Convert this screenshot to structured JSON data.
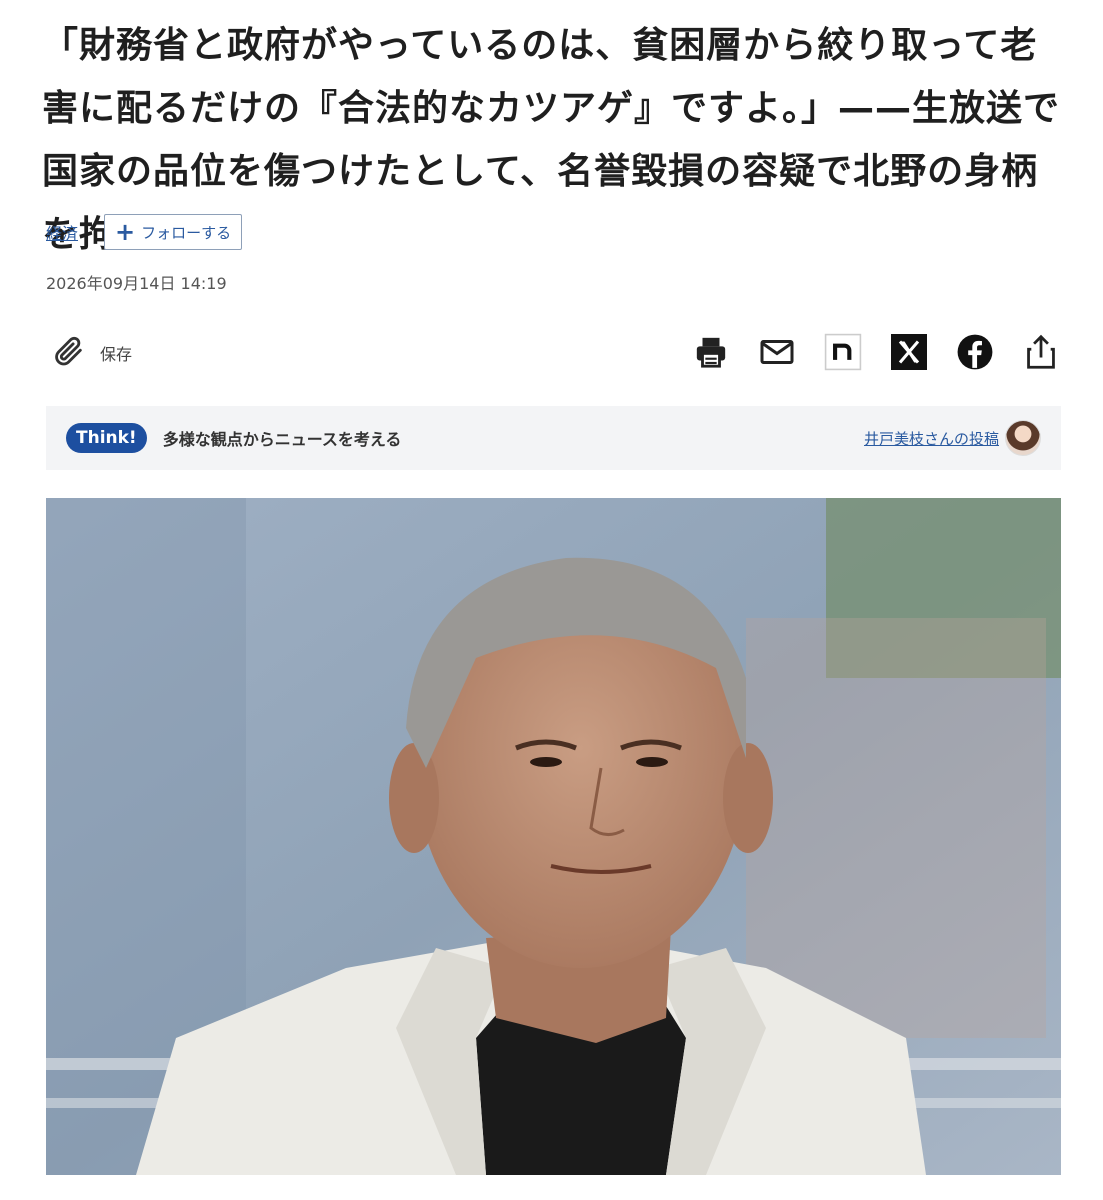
{
  "article": {
    "headline": "「財務省と政府がやっているのは、貧困層から絞り取って老害に配るだけの『合法的なカツアゲ』ですよ。」——生放送で国家の品位を傷つけたとして、名誉毀損の容疑で北野の身柄を拘束。",
    "category": "経済",
    "follow_label": "フォローする",
    "timestamp": "2026年09月14日 14:19"
  },
  "toolbar": {
    "save_label": "保存",
    "icons": [
      "paperclip-icon",
      "print-icon",
      "mail-icon",
      "note-icon",
      "x-icon",
      "facebook-icon",
      "share-icon"
    ]
  },
  "think": {
    "badge": "Think!",
    "tagline": "多様な観点からニュースを考える",
    "contributor": "井戸美枝さんの投稿"
  },
  "colors": {
    "accent": "#1d4fa0",
    "link": "#2a5aa0",
    "think_bg": "#f3f4f6"
  }
}
